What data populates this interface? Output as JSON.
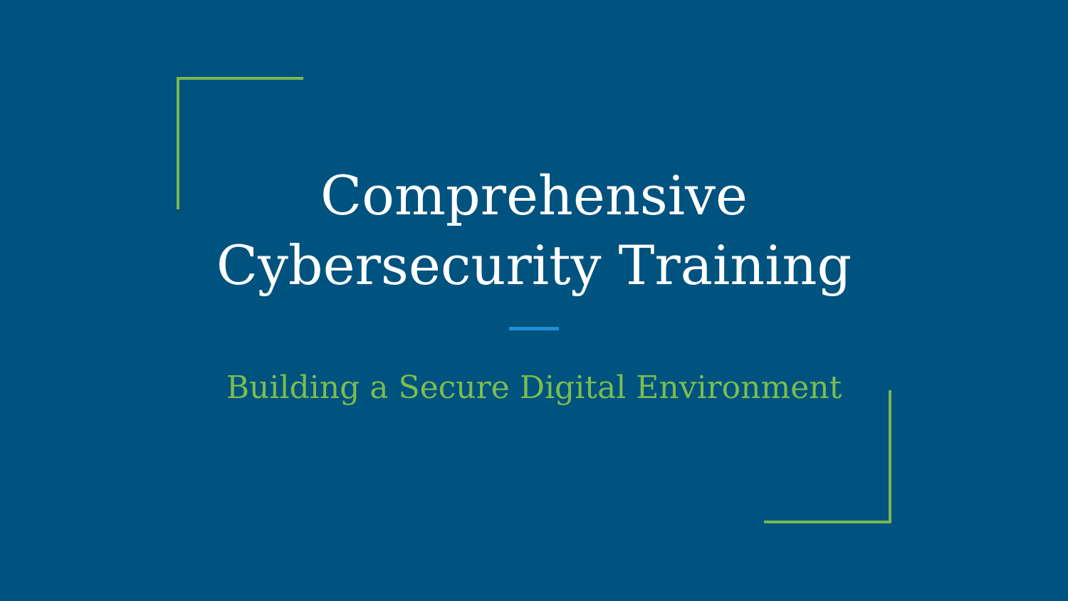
{
  "slide": {
    "title_line_1": "Comprehensive",
    "title_line_2": "Cybersecurity Training",
    "subtitle": "Building a Secure Digital Environment"
  },
  "colors": {
    "background": "#00527f",
    "accent_green": "#79b94f",
    "accent_blue": "#1e8fd6",
    "title_text": "#ffffff"
  }
}
